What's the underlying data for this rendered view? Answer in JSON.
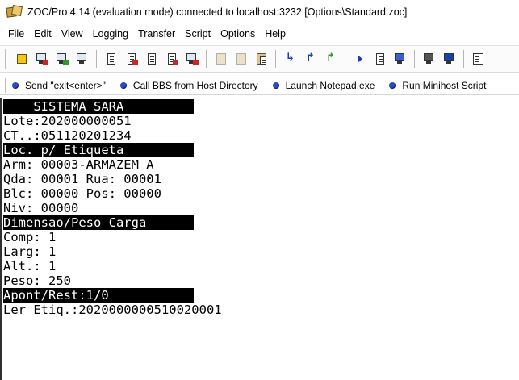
{
  "window": {
    "title": "ZOC/Pro 4.14  (evaluation mode) connected to localhost:3232 [Options\\Standard.zoc]"
  },
  "menu": [
    "File",
    "Edit",
    "View",
    "Logging",
    "Transfer",
    "Script",
    "Options",
    "Help"
  ],
  "toolbar": {
    "buttons": [
      {
        "name": "open-session-icon"
      },
      {
        "name": "connect-icon"
      },
      {
        "name": "disconnect-icon"
      },
      {
        "name": "address-book-icon"
      },
      {
        "name": "session-1-icon"
      },
      {
        "name": "session-2-icon"
      },
      {
        "name": "session-3-icon"
      },
      {
        "name": "session-4-icon"
      },
      {
        "name": "session-5-icon"
      },
      {
        "name": "copy-icon"
      },
      {
        "name": "paste-icon"
      },
      {
        "name": "clipboard-icon"
      },
      {
        "name": "upload-icon"
      },
      {
        "name": "download-icon"
      },
      {
        "name": "transfer-icon"
      },
      {
        "name": "run-script-icon"
      },
      {
        "name": "edit-script-icon"
      },
      {
        "name": "user-icon"
      },
      {
        "name": "print-icon"
      },
      {
        "name": "screen-icon"
      },
      {
        "name": "notes-icon"
      }
    ]
  },
  "quickbar": {
    "items": [
      {
        "label": "Send \"exit<enter>\""
      },
      {
        "label": "Call BBS from Host Directory"
      },
      {
        "label": "Launch Notepad.exe"
      },
      {
        "label": "Run Minihost Script"
      }
    ]
  },
  "terminal": {
    "lines": [
      {
        "text": "    SISTEMA SARA",
        "inverse": true
      },
      {
        "text": "Lote:202000000051",
        "inverse": false
      },
      {
        "text": "CT..:051120201234",
        "inverse": false
      },
      {
        "text": "Loc. p/ Etiqueta",
        "inverse": true
      },
      {
        "text": "Arm: 00003-ARMAZEM A",
        "inverse": false
      },
      {
        "text": "Qda: 00001 Rua: 00001",
        "inverse": false
      },
      {
        "text": "Blc: 00000 Pos: 00000",
        "inverse": false
      },
      {
        "text": "Niv: 00000",
        "inverse": false
      },
      {
        "text": "Dimensao/Peso Carga",
        "inverse": true
      },
      {
        "text": "Comp: 1",
        "inverse": false
      },
      {
        "text": "Larg: 1",
        "inverse": false
      },
      {
        "text": "Alt.: 1",
        "inverse": false
      },
      {
        "text": "Peso: 250",
        "inverse": false
      },
      {
        "text": "Apont/Rest:1/0",
        "inverse": true
      },
      {
        "text": "Ler Etiq.:2020000000510020001",
        "inverse": false
      }
    ]
  }
}
